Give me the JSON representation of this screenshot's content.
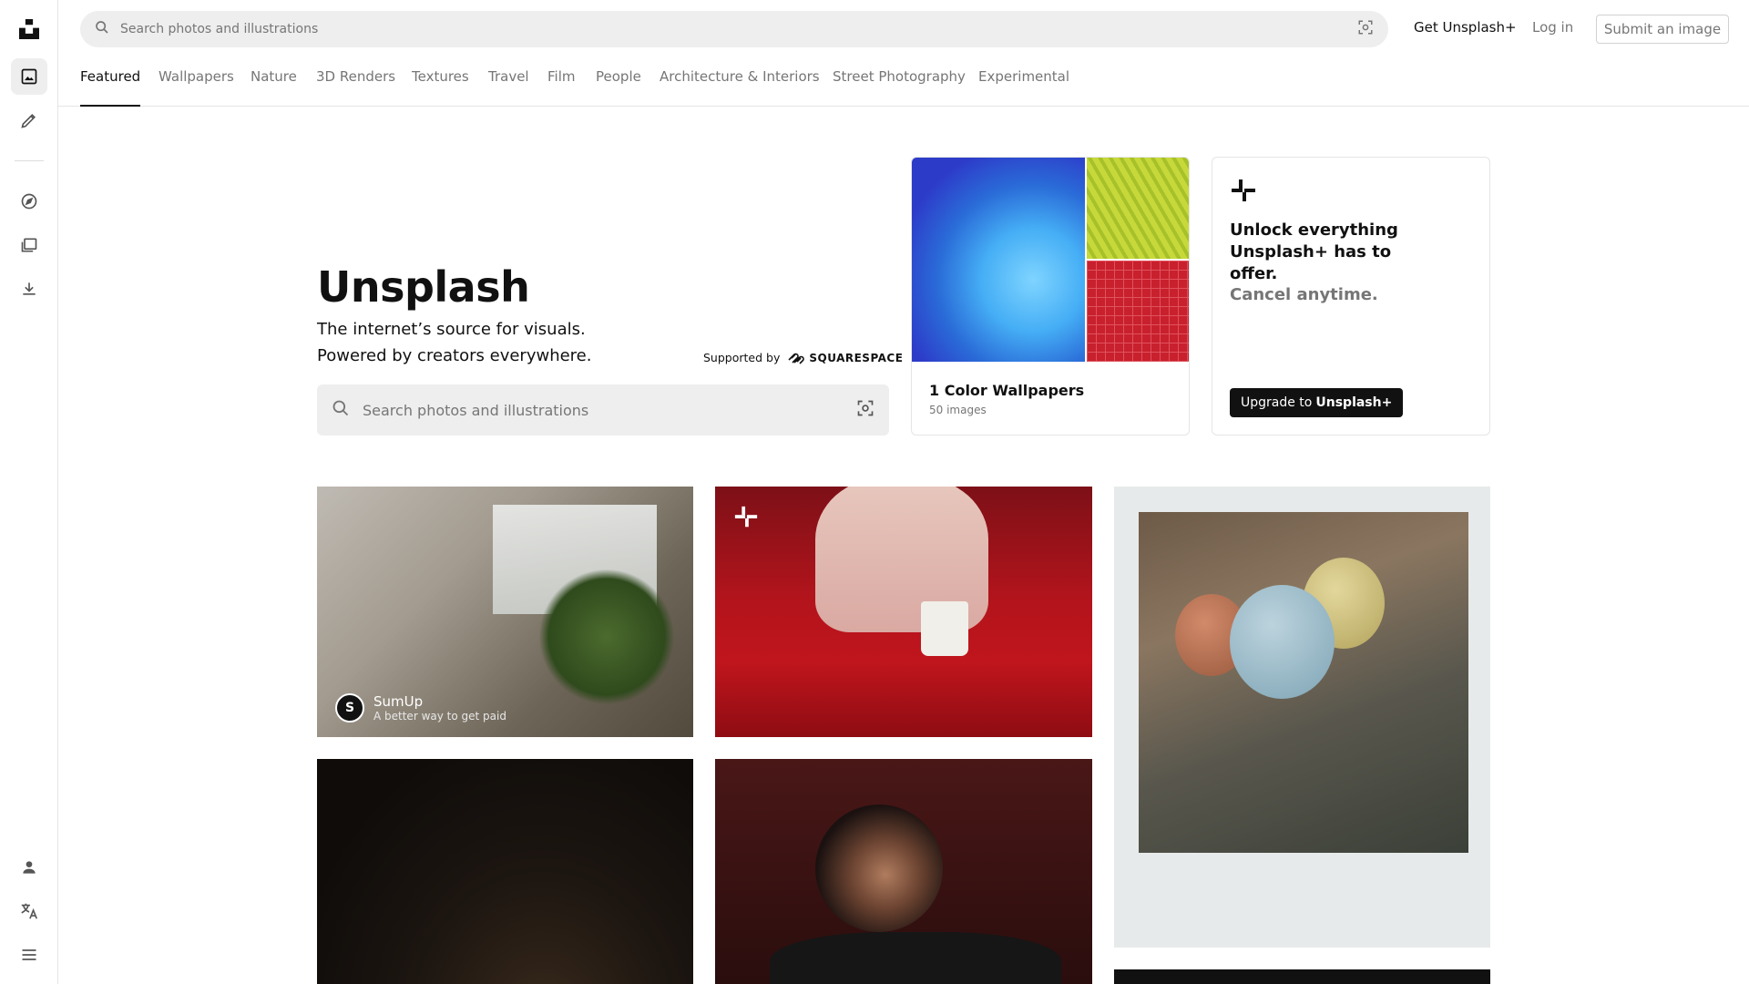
{
  "header": {
    "search_placeholder": "Search photos and illustrations",
    "get_plus": "Get Unsplash+",
    "login": "Log in",
    "submit": "Submit an image"
  },
  "topics": [
    "Featured",
    "Wallpapers",
    "Nature",
    "3D Renders",
    "Textures",
    "Travel",
    "Film",
    "People",
    "Architecture & Interiors",
    "Street Photography",
    "Experimental"
  ],
  "active_topic": "Featured",
  "hero": {
    "title": "Unsplash",
    "line1": "The internet’s source for visuals.",
    "line2": "Powered by creators everywhere.",
    "supported_by": "Supported by",
    "sponsor": "SQUARESPACE",
    "search_placeholder": "Search photos and illustrations"
  },
  "collection_card": {
    "title": "1 Color Wallpapers",
    "count": "50 images"
  },
  "plus_card": {
    "headline": "Unlock everything Unsplash+ has to offer.",
    "cancel": "Cancel anytime.",
    "button_prefix": "Upgrade to",
    "button_brand": "Unsplash+"
  },
  "sponsored_photo": {
    "brand": "SumUp",
    "tagline": "A better way to get paid"
  },
  "colors": {
    "accent": "#111111",
    "muted_text": "#767676",
    "search_bg": "#eeeeee"
  }
}
